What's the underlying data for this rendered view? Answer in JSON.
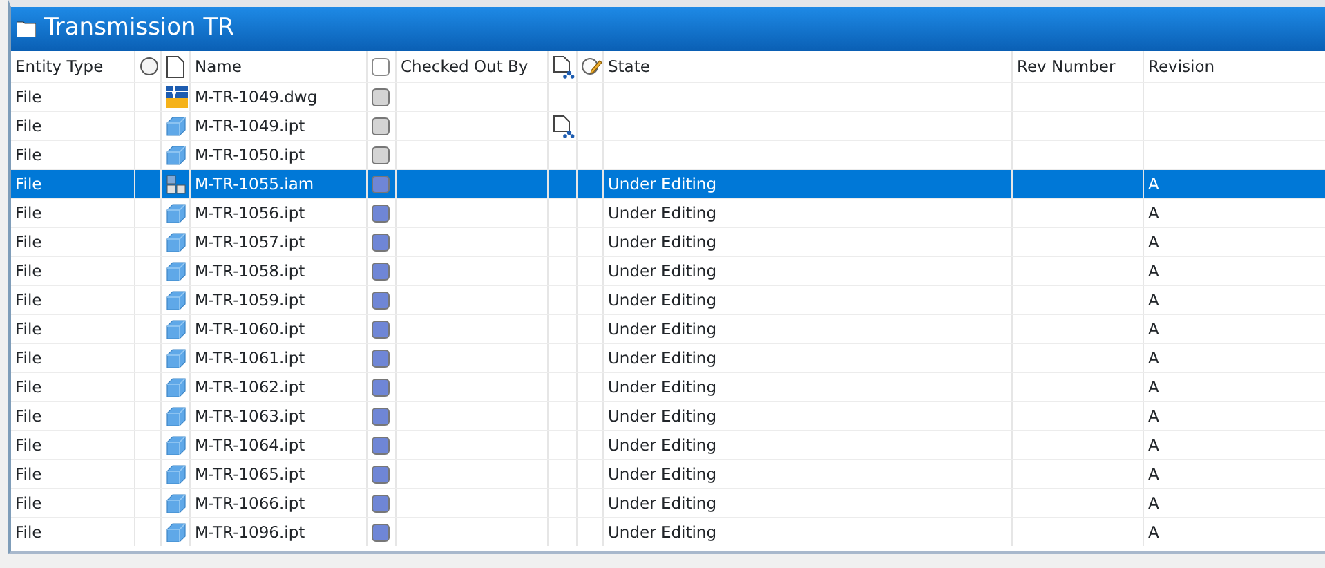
{
  "window": {
    "title": "Transmission TR"
  },
  "columns": [
    "Entity Type",
    "Name",
    "Checked Out By",
    "State",
    "Rev Number",
    "Revision"
  ],
  "header_checkbox": {
    "checked": false
  },
  "rows": [
    {
      "entity_type": "File",
      "kind": "drawing",
      "name": "M-TR-1049.dwg",
      "color": "#d4d4d4",
      "linked": false,
      "state": "",
      "revision": "",
      "selected": false
    },
    {
      "entity_type": "File",
      "kind": "part",
      "name": "M-TR-1049.ipt",
      "color": "#d4d4d4",
      "linked": true,
      "state": "",
      "revision": "",
      "selected": false
    },
    {
      "entity_type": "File",
      "kind": "part",
      "name": "M-TR-1050.ipt",
      "color": "#d4d4d4",
      "linked": false,
      "state": "",
      "revision": "",
      "selected": false
    },
    {
      "entity_type": "File",
      "kind": "assembly",
      "name": "M-TR-1055.iam",
      "color": "#6f86d6",
      "linked": false,
      "state": "Under Editing",
      "revision": "A",
      "selected": true
    },
    {
      "entity_type": "File",
      "kind": "part",
      "name": "M-TR-1056.ipt",
      "color": "#6f86d6",
      "linked": false,
      "state": "Under Editing",
      "revision": "A",
      "selected": false
    },
    {
      "entity_type": "File",
      "kind": "part",
      "name": "M-TR-1057.ipt",
      "color": "#6f86d6",
      "linked": false,
      "state": "Under Editing",
      "revision": "A",
      "selected": false
    },
    {
      "entity_type": "File",
      "kind": "part",
      "name": "M-TR-1058.ipt",
      "color": "#6f86d6",
      "linked": false,
      "state": "Under Editing",
      "revision": "A",
      "selected": false
    },
    {
      "entity_type": "File",
      "kind": "part",
      "name": "M-TR-1059.ipt",
      "color": "#6f86d6",
      "linked": false,
      "state": "Under Editing",
      "revision": "A",
      "selected": false
    },
    {
      "entity_type": "File",
      "kind": "part",
      "name": "M-TR-1060.ipt",
      "color": "#6f86d6",
      "linked": false,
      "state": "Under Editing",
      "revision": "A",
      "selected": false
    },
    {
      "entity_type": "File",
      "kind": "part",
      "name": "M-TR-1061.ipt",
      "color": "#6f86d6",
      "linked": false,
      "state": "Under Editing",
      "revision": "A",
      "selected": false
    },
    {
      "entity_type": "File",
      "kind": "part",
      "name": "M-TR-1062.ipt",
      "color": "#6f86d6",
      "linked": false,
      "state": "Under Editing",
      "revision": "A",
      "selected": false
    },
    {
      "entity_type": "File",
      "kind": "part",
      "name": "M-TR-1063.ipt",
      "color": "#6f86d6",
      "linked": false,
      "state": "Under Editing",
      "revision": "A",
      "selected": false
    },
    {
      "entity_type": "File",
      "kind": "part",
      "name": "M-TR-1064.ipt",
      "color": "#6f86d6",
      "linked": false,
      "state": "Under Editing",
      "revision": "A",
      "selected": false
    },
    {
      "entity_type": "File",
      "kind": "part",
      "name": "M-TR-1065.ipt",
      "color": "#6f86d6",
      "linked": false,
      "state": "Under Editing",
      "revision": "A",
      "selected": false
    },
    {
      "entity_type": "File",
      "kind": "part",
      "name": "M-TR-1066.ipt",
      "color": "#6f86d6",
      "linked": false,
      "state": "Under Editing",
      "revision": "A",
      "selected": false
    },
    {
      "entity_type": "File",
      "kind": "part",
      "name": "M-TR-1096.ipt",
      "color": "#6f86d6",
      "linked": false,
      "state": "Under Editing",
      "revision": "A",
      "selected": false
    }
  ]
}
